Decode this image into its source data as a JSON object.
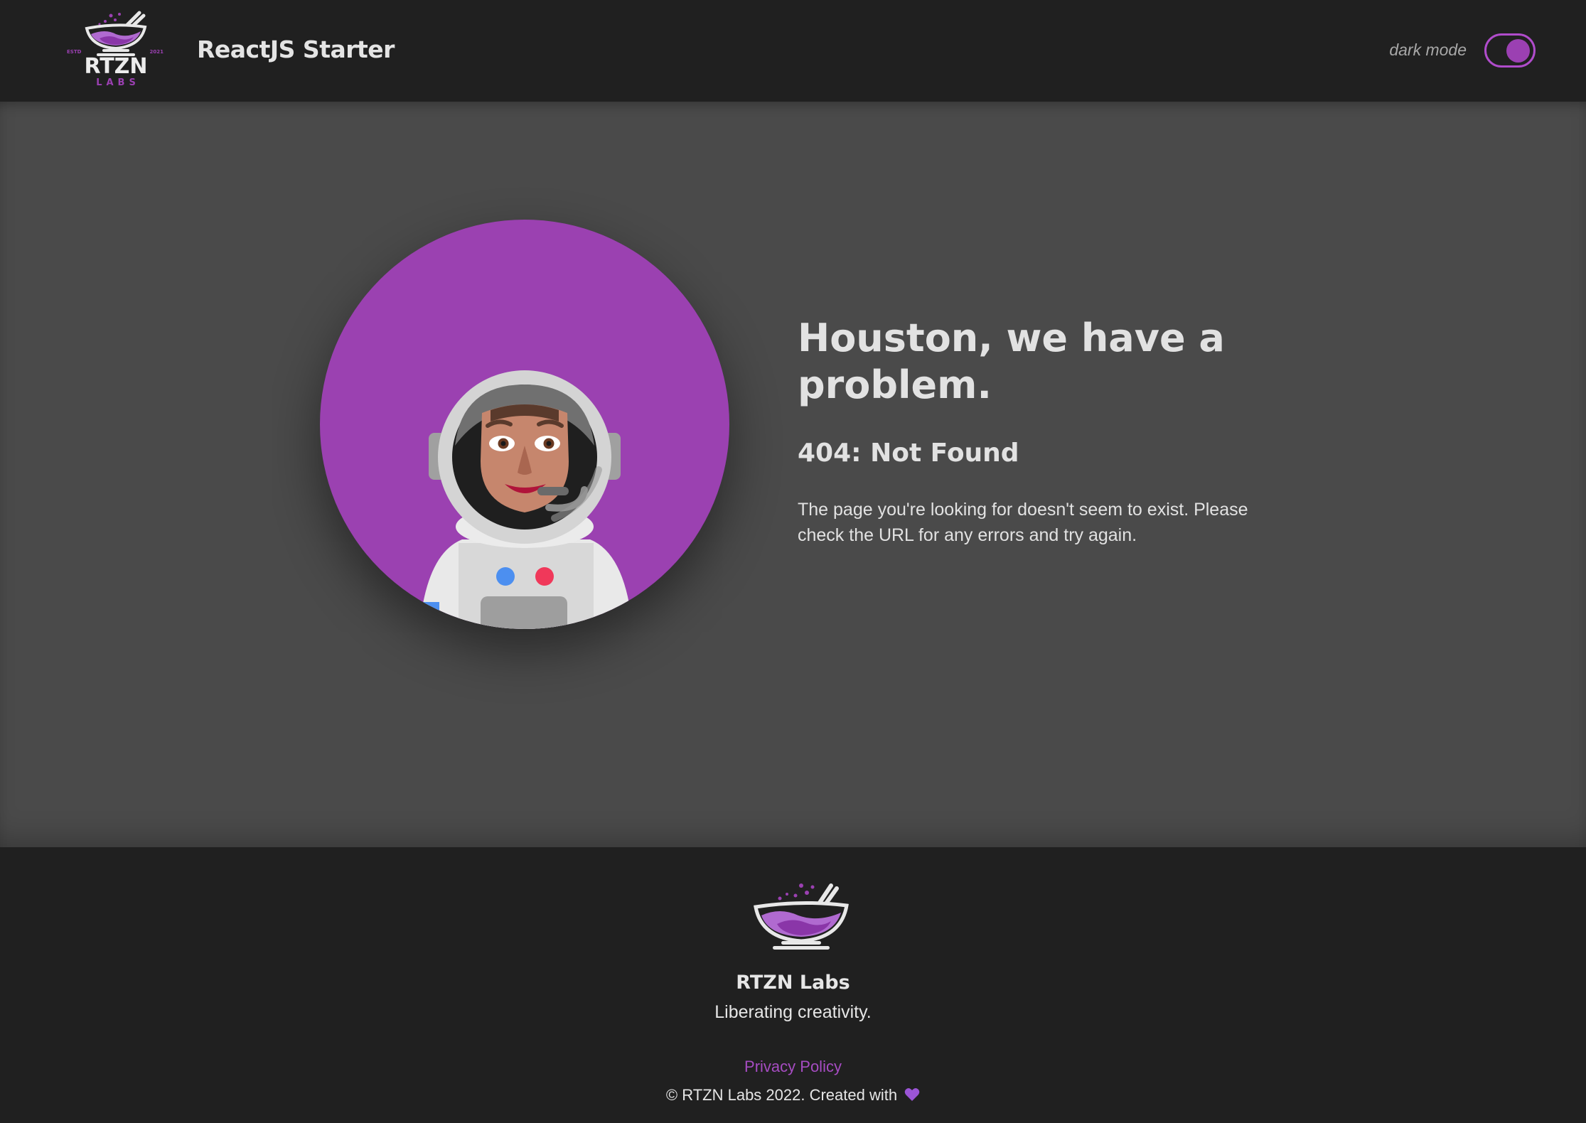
{
  "header": {
    "logo": {
      "estd": "ESTD",
      "year": "2021",
      "name": "RTZN",
      "sub": "LABS",
      "icon": "mortar-bowl-icon"
    },
    "title": "ReactJS Starter",
    "dark_mode_label": "dark mode",
    "dark_mode_on": true
  },
  "main": {
    "illustration": "astronaut-icon",
    "heading": "Houston, we have a problem.",
    "code": "404: Not Found",
    "message": "The page you're looking for doesn't seem to exist. Please check the URL for any errors and try again."
  },
  "footer": {
    "logo_icon": "mortar-bowl-icon",
    "brand": "RTZN Labs",
    "tagline": "Liberating creativity.",
    "privacy_label": "Privacy Policy",
    "copyright": "© RTZN Labs 2022. Created with",
    "heart_icon": "heart-icon"
  },
  "colors": {
    "accent": "#9b41b1",
    "header_bg": "#202020",
    "main_bg": "#4a4a4a",
    "text": "#e2e2e2"
  }
}
